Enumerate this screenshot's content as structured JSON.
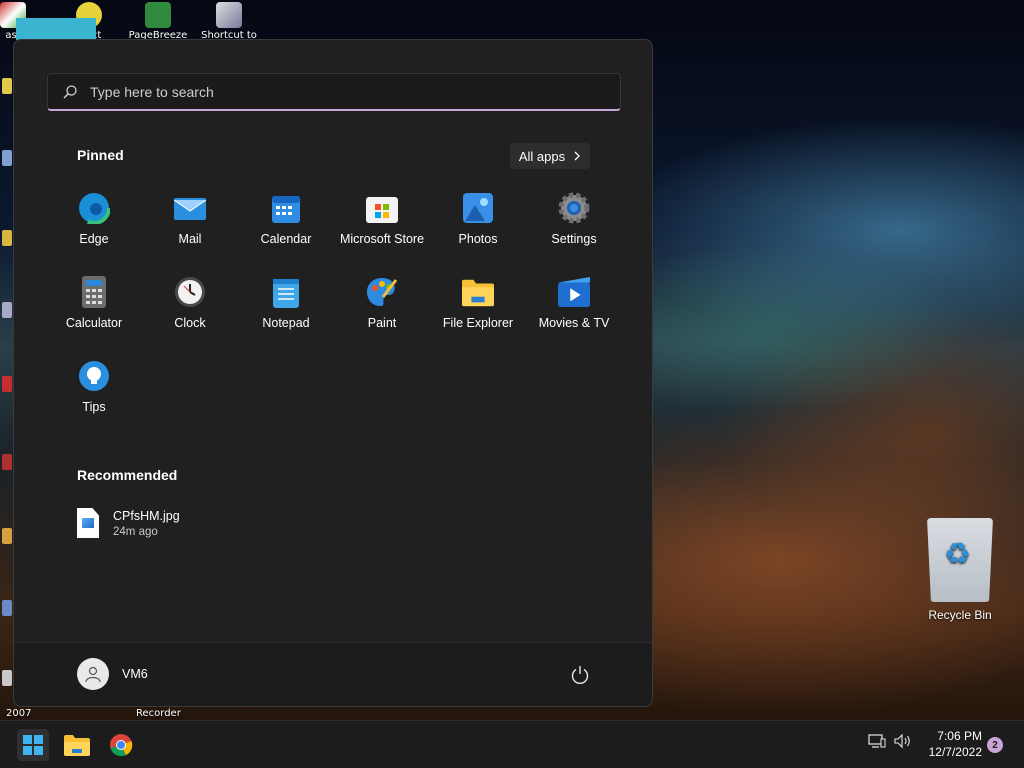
{
  "desktop": {
    "top_icons": [
      {
        "label": "ast",
        "icon": "app-icon"
      },
      {
        "label": "oject",
        "icon": "project-icon"
      },
      {
        "label": "PageBreeze",
        "icon": "pagebreeze-icon"
      },
      {
        "label": "Shortcut to",
        "icon": "shortcut-icon"
      }
    ],
    "bottom_labels": {
      "left": "2007",
      "right": "Recorder"
    },
    "recycle_bin": {
      "label": "Recycle Bin"
    }
  },
  "start_menu": {
    "search": {
      "placeholder": "Type here to search"
    },
    "pinned_title": "Pinned",
    "all_apps_label": "All apps",
    "pinned": [
      {
        "label": "Edge",
        "icon": "edge-icon"
      },
      {
        "label": "Mail",
        "icon": "mail-icon"
      },
      {
        "label": "Calendar",
        "icon": "calendar-icon"
      },
      {
        "label": "Microsoft Store",
        "icon": "store-icon"
      },
      {
        "label": "Photos",
        "icon": "photos-icon"
      },
      {
        "label": "Settings",
        "icon": "settings-icon"
      },
      {
        "label": "Calculator",
        "icon": "calculator-icon"
      },
      {
        "label": "Clock",
        "icon": "clock-icon"
      },
      {
        "label": "Notepad",
        "icon": "notepad-icon"
      },
      {
        "label": "Paint",
        "icon": "paint-icon"
      },
      {
        "label": "File Explorer",
        "icon": "folder-icon"
      },
      {
        "label": "Movies & TV",
        "icon": "movies-icon"
      },
      {
        "label": "Tips",
        "icon": "tips-icon"
      }
    ],
    "recommended_title": "Recommended",
    "recommended": [
      {
        "name": "CPfsHM.jpg",
        "time": "24m ago"
      }
    ],
    "user": {
      "name": "VM6"
    }
  },
  "taskbar": {
    "clock": {
      "time": "7:06 PM",
      "date": "12/7/2022"
    },
    "notification_count": "2"
  },
  "colors": {
    "accent": "#c9a4d6",
    "menu_bg": "#202020",
    "taskbar_bg": "#1c1c1c"
  }
}
